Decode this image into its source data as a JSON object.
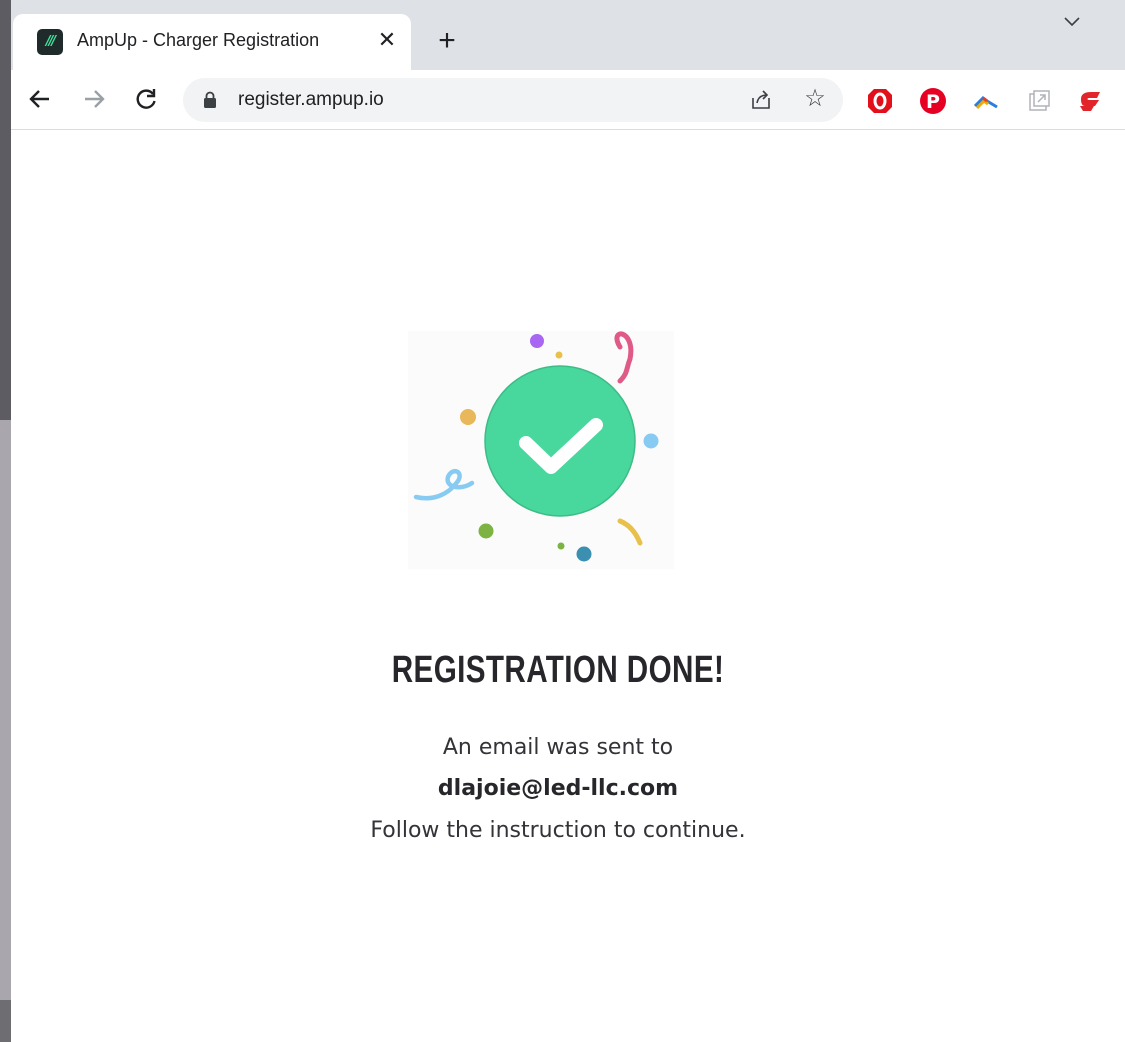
{
  "browser": {
    "tab": {
      "favicon_text": "///",
      "title": "AmpUp - Charger Registration",
      "close_label": "✕"
    },
    "new_tab_label": "+",
    "toolbar": {
      "back_icon": "arrow-left-icon",
      "forward_icon": "arrow-right-icon",
      "reload_icon": "reload-icon",
      "url": "register.ampup.io",
      "bookmark_icon": "star-icon",
      "share_icon": "share-icon"
    },
    "extensions": [
      "opera-adblock-icon",
      "pinterest-icon",
      "rainbow-extension-icon",
      "popout-icon",
      "red-extension-icon"
    ]
  },
  "page": {
    "headline": "REGISTRATION DONE!",
    "message_line_1": "An email was sent to",
    "email": "dlajoie@led-llc.com",
    "message_line_3": "Follow the instruction to continue."
  },
  "colors": {
    "check_circle": "#48d79c",
    "headline": "#26262b",
    "tab_bar": "#dee1e6"
  }
}
